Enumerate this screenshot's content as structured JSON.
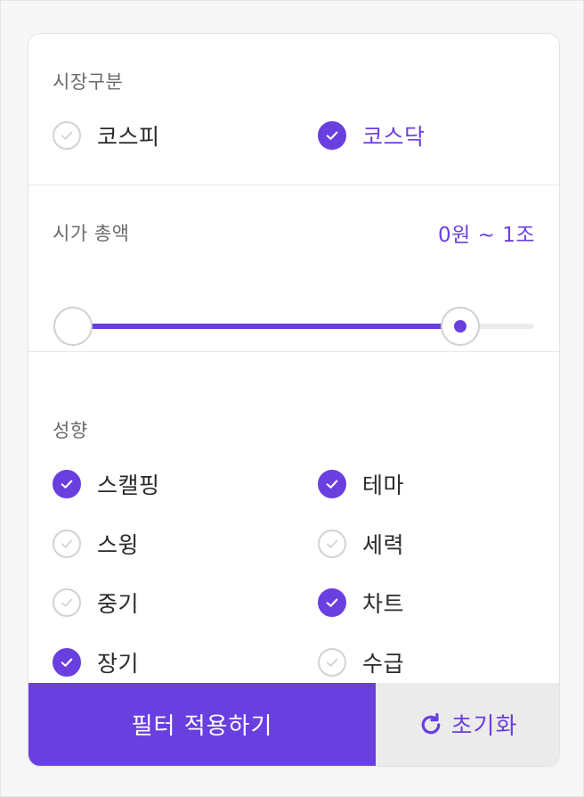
{
  "market": {
    "title": "시장구분",
    "options": [
      {
        "label": "코스피",
        "checked": false
      },
      {
        "label": "코스닥",
        "checked": true
      }
    ]
  },
  "market_cap": {
    "title": "시가 총액",
    "range_text": "0원 ~ 1조",
    "slider": {
      "min_fraction": 0.0,
      "max_fraction": 0.84
    }
  },
  "style": {
    "title": "성향",
    "options": [
      {
        "label": "스캘핑",
        "checked": true
      },
      {
        "label": "테마",
        "checked": true
      },
      {
        "label": "스윙",
        "checked": false
      },
      {
        "label": "세력",
        "checked": false
      },
      {
        "label": "중기",
        "checked": false
      },
      {
        "label": "차트",
        "checked": true
      },
      {
        "label": "장기",
        "checked": true
      },
      {
        "label": "수급",
        "checked": false
      }
    ]
  },
  "actions": {
    "apply_label": "필터 적용하기",
    "reset_label": "초기화",
    "reset_icon": "refresh-icon"
  },
  "colors": {
    "accent": "#6a3fe0",
    "unchecked_border": "#d2d2d2",
    "reset_bg": "#ebebeb"
  }
}
